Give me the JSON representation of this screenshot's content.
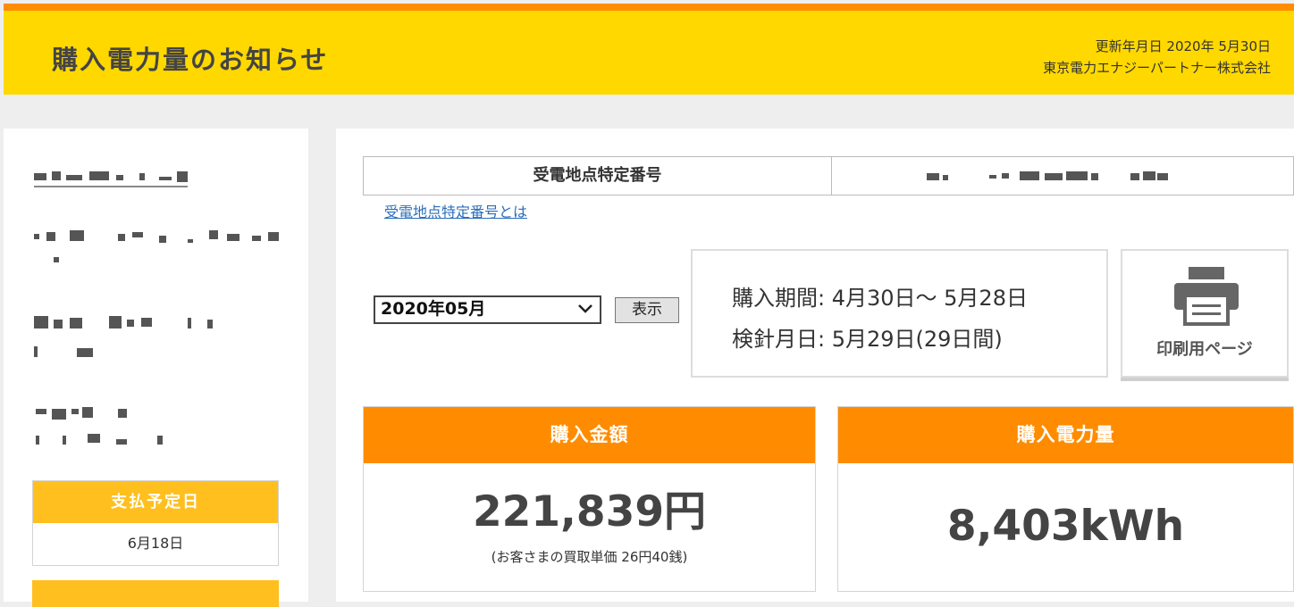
{
  "header": {
    "title": "購入電力量のお知らせ",
    "updated": "更新年月日  2020年 5月30日",
    "company": "東京電力エナジーパートナー株式会社"
  },
  "sidebar": {
    "payment_due_label": "支払予定日",
    "payment_due_value": "6月18日"
  },
  "supply_point": {
    "label": "受電地点特定番号",
    "link": "受電地点特定番号とは"
  },
  "month_select": {
    "selected": "2020年05月"
  },
  "show_button": "表示",
  "period": {
    "purchase_period": "購入期間: 4月30日～ 5月28日",
    "meter_date": "検針月日: 5月29日(29日間)"
  },
  "print_button": {
    "label": "印刷用ページ",
    "icon": "printer-icon"
  },
  "cards": {
    "amount": {
      "label": "購入金額",
      "value": "221,839円",
      "note": "(お客さまの買取単価 26円40銭)"
    },
    "energy": {
      "label": "購入電力量",
      "value": "8,403kWh"
    }
  },
  "colors": {
    "accent": "#ff8c00",
    "header": "#ffd800",
    "sub_accent": "#ffbf1e"
  }
}
